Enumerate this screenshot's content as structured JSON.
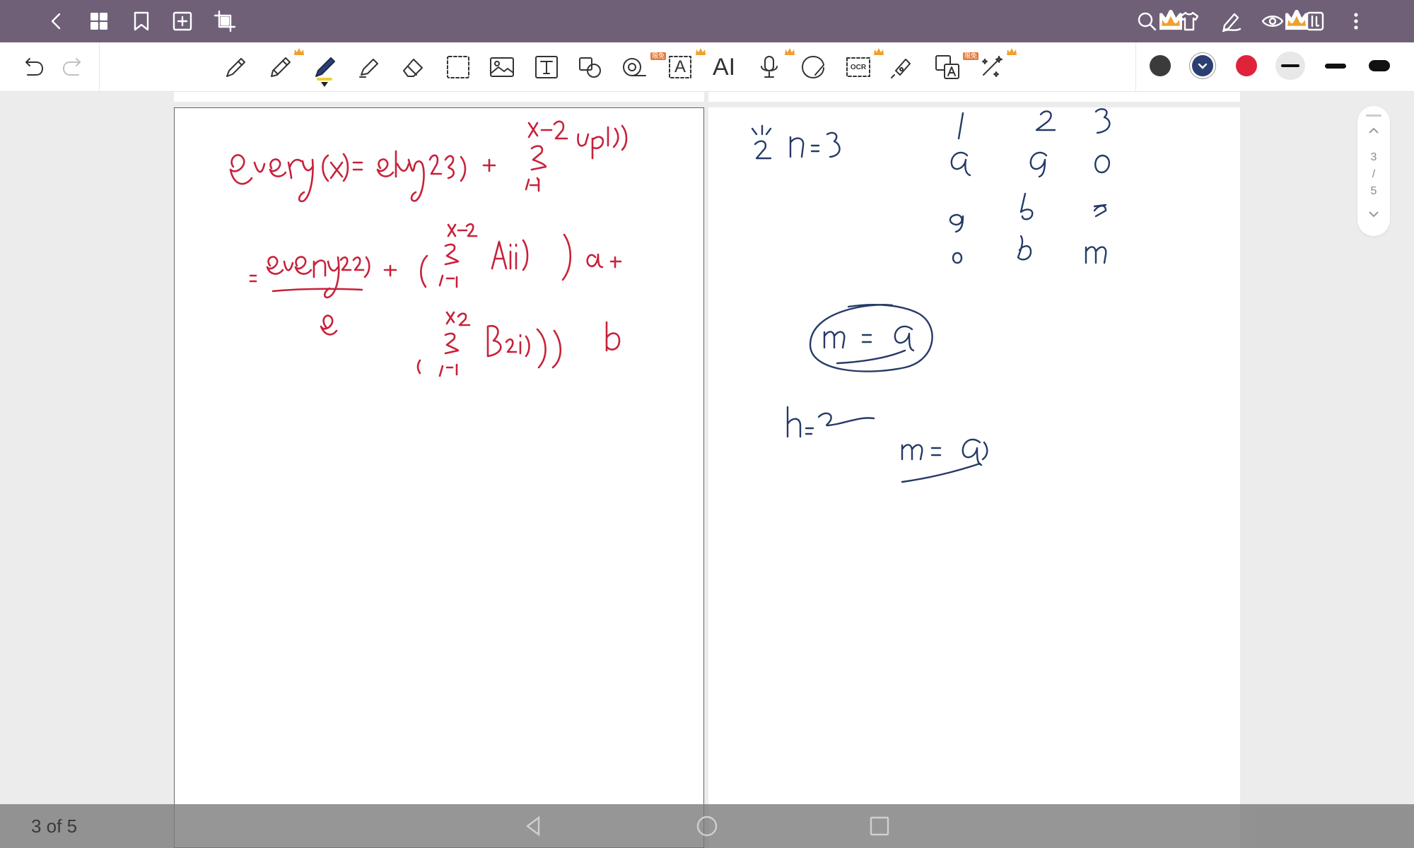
{
  "top_bar": {
    "icons": [
      "back-icon",
      "grid-icon",
      "bookmark-icon",
      "add-page-icon",
      "crop-icon",
      "search-icon",
      "theme-shirt-icon",
      "handwriting-icon",
      "eye-icon",
      "read-mode-icon",
      "more-icon"
    ]
  },
  "toolbar": {
    "tools": [
      "fountain-pen-icon",
      "pencil-icon",
      "marker-pen-icon",
      "highlighter-icon",
      "eraser-icon",
      "lasso-icon",
      "image-icon",
      "text-box-icon",
      "shape-icon",
      "tape-icon",
      "text-recognition-icon",
      "ai-tool",
      "microphone-icon",
      "sticker-icon",
      "ocr-icon",
      "laser-pointer-icon",
      "translate-icon",
      "magic-wand-icon"
    ],
    "ai_label": "AI",
    "ocr_label": "OCR",
    "badge_label": "限免",
    "colors": [
      "#3b3b3b",
      "#2b3f73",
      "#e0233a"
    ],
    "selected_color": "#2b3f73",
    "stroke_widths": [
      "thin",
      "medium",
      "thick"
    ]
  },
  "scroller": {
    "current": "3",
    "separator": "/",
    "total": "5"
  },
  "bottom": {
    "page_count": "3 of 5"
  }
}
